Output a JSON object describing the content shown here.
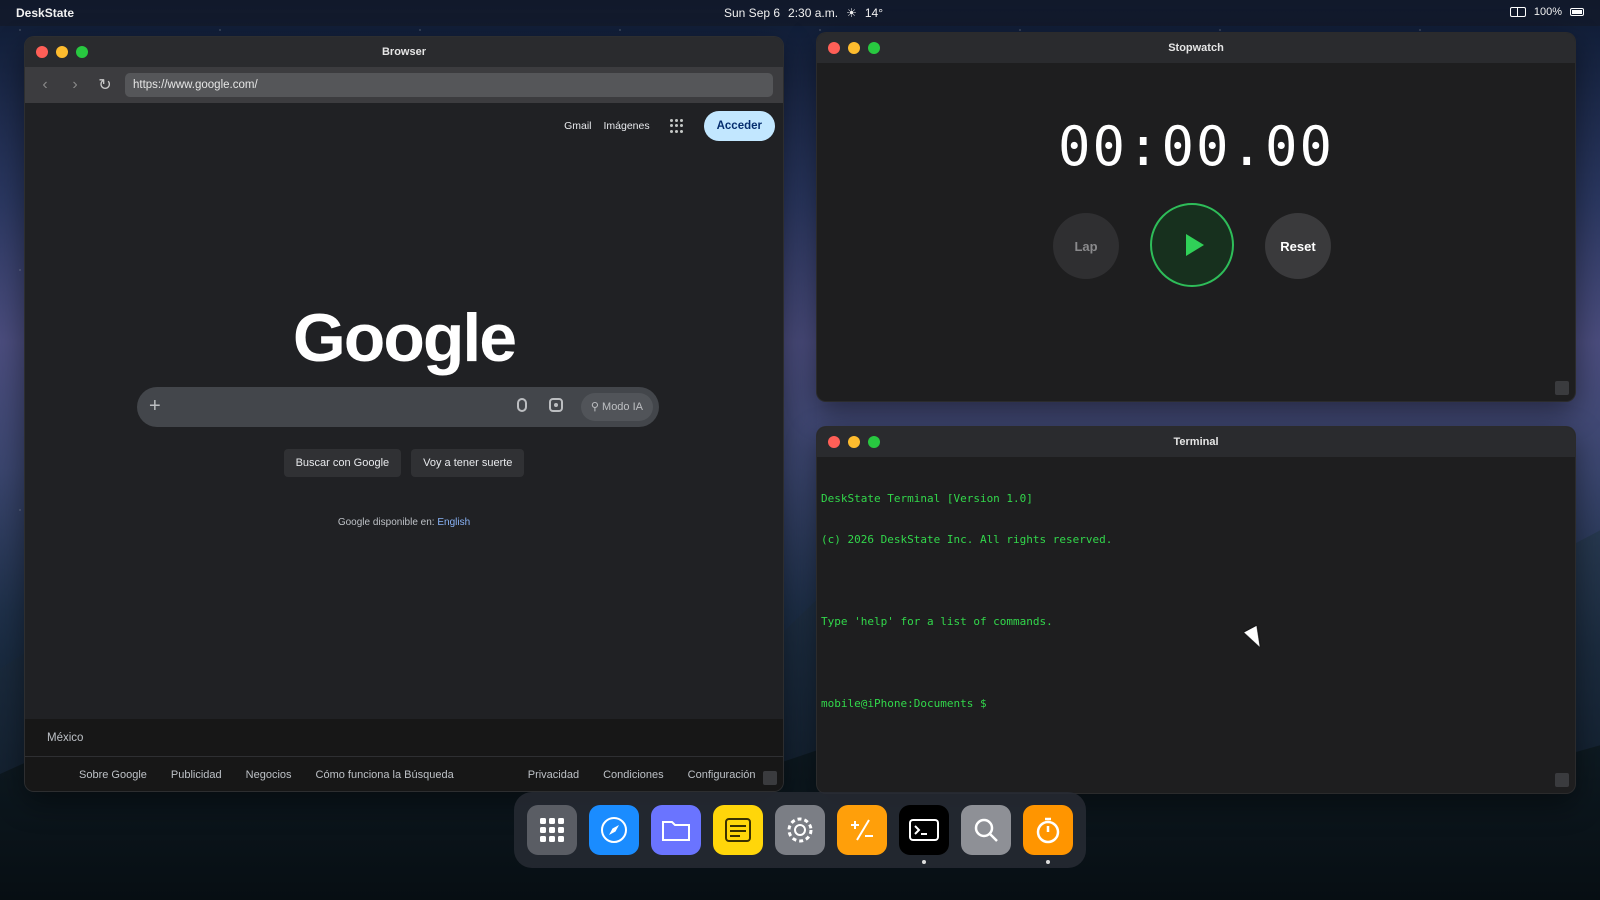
{
  "menubar": {
    "app_name": "DeskState",
    "date": "Sun Sep 6",
    "time": "2:30 a.m.",
    "weather": "14°",
    "battery": "100%"
  },
  "browser": {
    "title": "Browser",
    "url": "https://www.google.com/",
    "top_links": {
      "gmail": "Gmail",
      "images": "Imágenes"
    },
    "signin_label": "Acceder",
    "logo_text": "Google",
    "ai_mode_label": "Modo IA",
    "search_button": "Buscar con Google",
    "lucky_button": "Voy a tener suerte",
    "language_text": "Google disponible en:",
    "language_link": "English",
    "country": "México",
    "footer_links": [
      "Sobre Google",
      "Publicidad",
      "Negocios",
      "Cómo funciona la Búsqueda",
      "Privacidad",
      "Condiciones",
      "Configuración"
    ]
  },
  "stopwatch": {
    "title": "Stopwatch",
    "time": "00:00.00",
    "lap_label": "Lap",
    "reset_label": "Reset"
  },
  "terminal": {
    "title": "Terminal",
    "lines": [
      "DeskState Terminal [Version 1.0]",
      "(c) 2026 DeskState Inc. All rights reserved.",
      "Type 'help' for a list of commands.",
      "mobile@iPhone:Documents $"
    ]
  },
  "dock": [
    {
      "icon": "launchpad-icon",
      "color": "#5a5d64"
    },
    {
      "icon": "safari-compass-icon",
      "color": "#1a8cff"
    },
    {
      "icon": "files-folder-icon",
      "color": "#6a74ff"
    },
    {
      "icon": "notes-icon",
      "color": "#ffd60a"
    },
    {
      "icon": "settings-gear-icon",
      "color": "#7b7e85"
    },
    {
      "icon": "calculator-icon",
      "color": "#ff9f0a"
    },
    {
      "icon": "terminal-icon",
      "color": "#000000"
    },
    {
      "icon": "search-magnifier-icon",
      "color": "#8e9096"
    },
    {
      "icon": "stopwatch-icon",
      "color": "#ff9500"
    }
  ]
}
